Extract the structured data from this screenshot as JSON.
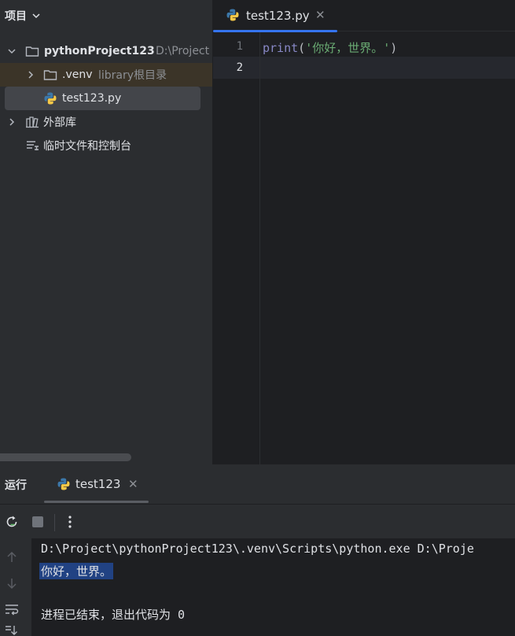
{
  "project_panel": {
    "title": "项目",
    "tree": {
      "root_name": "pythonProject123",
      "root_path": "D:\\Project",
      "venv_name": ".venv",
      "venv_hint": "library根目录",
      "file_name": "test123.py",
      "external_libs": "外部库",
      "scratches": "临时文件和控制台"
    }
  },
  "editor": {
    "tab_label": "test123.py",
    "tab_close": "✕",
    "line_numbers": [
      "1",
      "2"
    ],
    "code": {
      "fn": "print",
      "open": "(",
      "str": "'你好，世界。'",
      "close": ")"
    }
  },
  "run_panel": {
    "title": "运行",
    "tab_label": "test123",
    "tab_close": "✕",
    "console": {
      "command": "D:\\Project\\pythonProject123\\.venv\\Scripts\\python.exe D:\\Proje",
      "output": "你好，世界。",
      "exit_message": "进程已结束，退出代码为 0"
    }
  },
  "colors": {
    "accent": "#3574f0",
    "panel_bg": "#2b2d30",
    "editor_bg": "#1e1f22",
    "selection": "#214283"
  }
}
